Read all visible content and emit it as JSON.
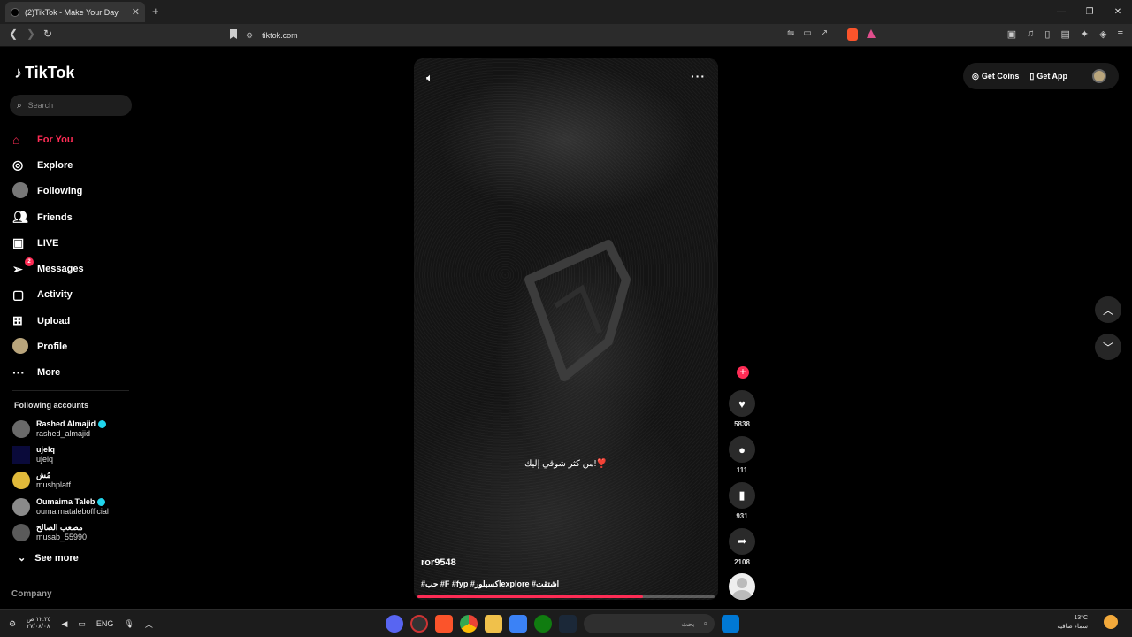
{
  "browser": {
    "tab_title": "(2)TikTok - Make Your Day",
    "tab_close": "✕",
    "new_tab": "+",
    "url": "tiktok.com",
    "window_controls": [
      "—",
      "❐",
      "✕"
    ]
  },
  "tiktok": {
    "logo_text": "TikTok",
    "search_placeholder": "Search",
    "menu": [
      {
        "label": "For You",
        "icon": "home-icon",
        "active": true
      },
      {
        "label": "Explore",
        "icon": "compass-icon"
      },
      {
        "label": "Following",
        "icon": "following-avatar-icon"
      },
      {
        "label": "Friends",
        "icon": "friends-icon"
      },
      {
        "label": "LIVE",
        "icon": "live-icon"
      },
      {
        "label": "Messages",
        "icon": "messages-icon",
        "badge": "2"
      },
      {
        "label": "Activity",
        "icon": "activity-icon"
      },
      {
        "label": "Upload",
        "icon": "upload-icon"
      },
      {
        "label": "Profile",
        "icon": "profile-avatar-icon"
      },
      {
        "label": "More",
        "icon": "more-icon"
      }
    ],
    "following_title": "Following accounts",
    "accounts": [
      {
        "name": "Rashed Almajid",
        "username": "rashed_almajid",
        "verified": true
      },
      {
        "name": "ujelq",
        "username": "ujelq",
        "verified": false
      },
      {
        "name": "مُش",
        "username": "mushplatf",
        "verified": false
      },
      {
        "name": "Oumaima Taleb",
        "username": "oumaimatalebofficial",
        "verified": true
      },
      {
        "name": "مصعب الصالح",
        "username": "musab_55990",
        "verified": false
      }
    ],
    "see_more": "See more",
    "company": "Company",
    "top_right": {
      "get_coins": "Get Coins",
      "get_app": "Get App"
    }
  },
  "video": {
    "caption_center": "من كثر شوقي إليك!❣️",
    "author": "ror9548",
    "tags": "#حب #F #fyp #اكسبلورexplore #اشتقت",
    "progress": 0.76,
    "likes": "5838",
    "comments": "111",
    "saves": "931",
    "shares": "2108"
  },
  "taskbar": {
    "lang": "ENG",
    "time": "١٢:٣٥ ص",
    "date": "٢٧/٠٨/٠٨",
    "search_placeholder": "بحث",
    "temp": "13°C",
    "weather": "سماء صافية"
  }
}
